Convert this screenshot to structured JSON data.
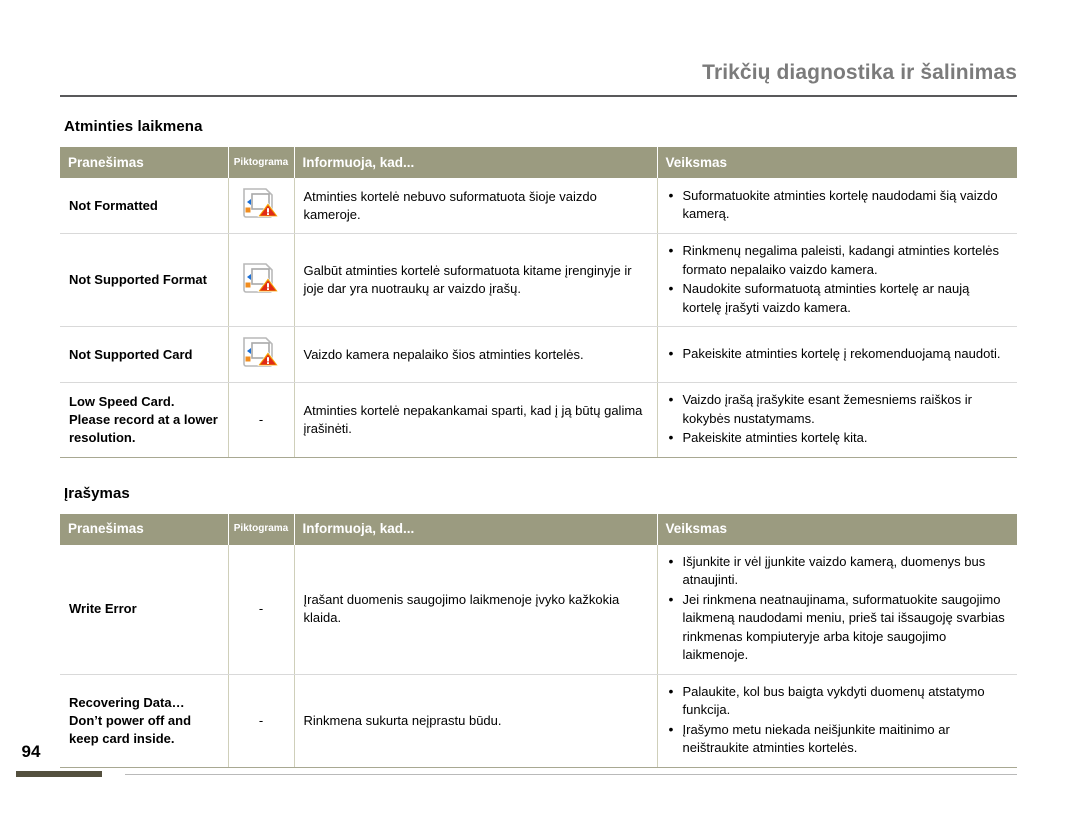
{
  "header": {
    "title": "Trikčių diagnostika ir šalinimas"
  },
  "page_number": "94",
  "sections": [
    {
      "heading": "Atminties laikmena",
      "columns": {
        "message": "Pranešimas",
        "pictogram": "Piktograma",
        "informs": "Informuoja, kad...",
        "action": "Veiksmas"
      },
      "rows": [
        {
          "message": "Not Formatted",
          "icon": "memory-card-warning-icon",
          "informs": "Atminties kortelė nebuvo suformatuota šioje vaizdo kameroje.",
          "actions": [
            "Suformatuokite atminties kortelę naudodami šią vaizdo kamerą."
          ]
        },
        {
          "message": "Not Supported Format",
          "icon": "memory-card-warning-icon",
          "informs": "Galbūt atminties kortelė suformatuota kitame įrenginyje ir joje dar yra nuotraukų ar vaizdo įrašų.",
          "actions": [
            "Rinkmenų negalima paleisti, kadangi atminties kortelės formato nepalaiko vaizdo kamera.",
            "Naudokite suformatuotą atminties kortelę ar naują kortelę įrašyti vaizdo kamera."
          ]
        },
        {
          "message": "Not Supported Card",
          "icon": "memory-card-warning-icon",
          "informs": "Vaizdo kamera nepalaiko šios atminties kortelės.",
          "actions": [
            "Pakeiskite atminties kortelę į rekomenduojamą naudoti."
          ]
        },
        {
          "message": "Low Speed Card. Please record at a lower resolution.",
          "icon": "dash",
          "informs": "Atminties kortelė nepakankamai sparti, kad į ją būtų galima įrašinėti.",
          "actions": [
            "Vaizdo įrašą įrašykite esant žemesniems raiškos ir kokybės nustatymams.",
            "Pakeiskite atminties kortelę kita."
          ]
        }
      ]
    },
    {
      "heading": "Įrašymas",
      "columns": {
        "message": "Pranešimas",
        "pictogram": "Piktograma",
        "informs": "Informuoja, kad...",
        "action": "Veiksmas"
      },
      "rows": [
        {
          "message": "Write Error",
          "icon": "dash",
          "informs": "Įrašant duomenis saugojimo laikmenoje įvyko kažkokia klaida.",
          "actions": [
            "Išjunkite ir vėl įjunkite vaizdo kamerą, duomenys bus atnaujinti.",
            "Jei rinkmena neatnaujinama, suformatuokite saugojimo laikmeną naudodami meniu, prieš tai išsaugoję svarbias rinkmenas kompiuteryje arba kitoje saugojimo laikmenoje."
          ]
        },
        {
          "message": "Recovering Data… Don’t power off and keep card inside.",
          "icon": "dash",
          "informs": "Rinkmena sukurta neįprastu būdu.",
          "actions": [
            "Palaukite, kol bus baigta vykdyti duomenų atstatymo funkcija.",
            "Įrašymo metu niekada neišjunkite maitinimo ar neištraukite atminties kortelės."
          ]
        }
      ]
    }
  ],
  "dash_symbol": "-",
  "colors": {
    "table_header": "#9b9b80",
    "header_rule": "#59595b",
    "title_text": "#7b7b7b",
    "page_bar": "#54503e",
    "warning_red": "#e02b17",
    "warning_orange": "#f5a200",
    "icon_blue": "#1b6fd6",
    "icon_orange": "#f08c1e"
  }
}
